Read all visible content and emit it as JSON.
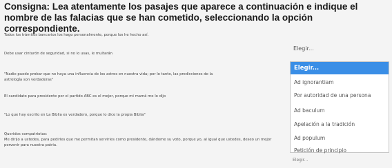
{
  "instructions": "Consigna: Lea atentamente los pasajes que aparece a continuación e indique el nombre de las falacias que se han cometido, seleccionando la opción correspondiente.",
  "passages": [
    "Todos los trámites bancarios los hago personalmente, porque los he hecho así.",
    "Debe usar cinturón de seguridad, si no lo usas, le multarán",
    "\"Nadie puede probar que no haya una influencia de los astros en nuestra vida; por lo tanto, las predicciones de la astrología son verdaderas\"",
    "El candidato para presidente por el partido ABC es el mejor, porque mi mamá me lo dijo",
    "\"Lo que hay escrito en La Biblia es verdadero, porque lo dice la propia Biblia\"",
    "Queridos compatriotas:",
    "Me dirijo a ustedes, para pedirles que me permitan servirles como presidente, dándome su voto, porque yo, al igual que ustedes, deseo un mejor porvenir para nuestra patria."
  ],
  "first_select": {
    "value": "Elegir..."
  },
  "dropdown_options": [
    "Elegir...",
    "Ad ignorantiam",
    "Por autoridad de una persona",
    "Ad baculum",
    "Apelación a la tradición",
    "Ad populum",
    "Petición de principio"
  ],
  "last_select": {
    "value": "Elegir..."
  }
}
